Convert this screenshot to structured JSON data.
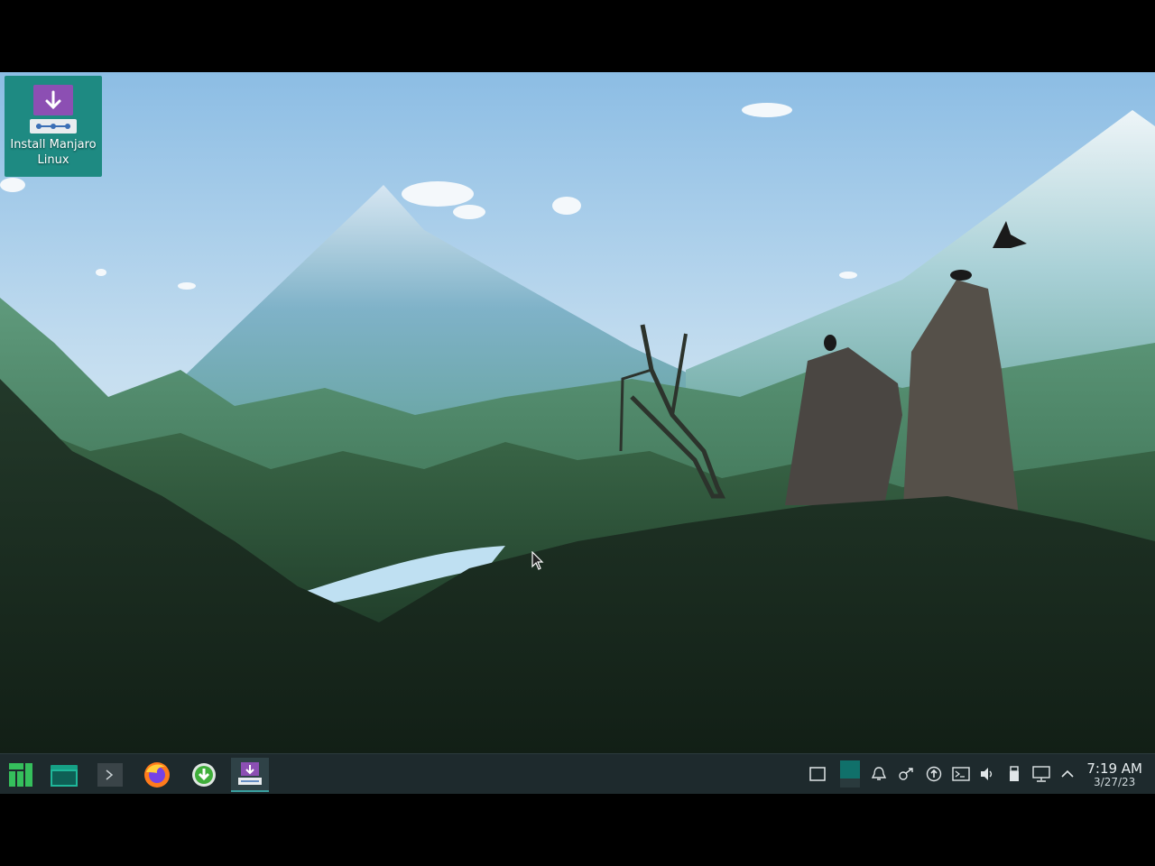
{
  "desktop": {
    "icons": [
      {
        "label": "Install Manjaro Linux"
      }
    ]
  },
  "taskbar": {
    "launchers": [
      {
        "name": "application-menu",
        "icon": "manjaro-logo-icon"
      },
      {
        "name": "file-manager",
        "icon": "folder-icon"
      },
      {
        "name": "terminal",
        "icon": "terminal-icon"
      },
      {
        "name": "firefox",
        "icon": "firefox-icon"
      },
      {
        "name": "download-manager",
        "icon": "download-icon"
      },
      {
        "name": "installer",
        "icon": "installer-icon",
        "active": true
      }
    ],
    "tray": [
      "show-desktop-icon",
      "virtual-desktop-icon",
      "notifications-icon",
      "kde-connect-icon",
      "updates-icon",
      "konsole-icon",
      "volume-icon",
      "usb-icon",
      "network-icon",
      "expand-tray-icon"
    ],
    "clock": {
      "time": "7:19 AM",
      "date": "3/27/23"
    }
  },
  "colors": {
    "taskbar": "#1e2a2d",
    "accent": "#1e8a82",
    "installer": "#8c4fb3"
  }
}
